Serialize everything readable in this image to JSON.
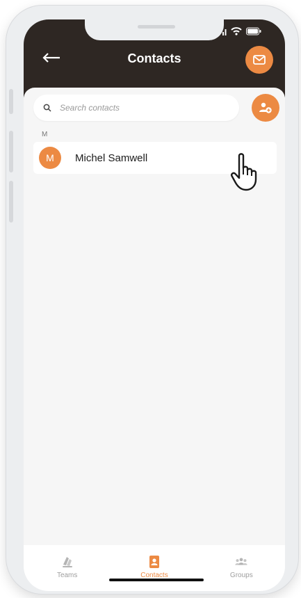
{
  "status_bar": {
    "icons": [
      "signal-icon",
      "wifi-icon",
      "battery-icon"
    ]
  },
  "header": {
    "title": "Contacts",
    "back_icon": "back-arrow-icon",
    "action_icon": "mail-icon"
  },
  "search": {
    "placeholder": "Search contacts",
    "value": ""
  },
  "add_contact_icon": "add-contact-icon",
  "contacts": {
    "sections": [
      {
        "letter": "M",
        "items": [
          {
            "initial": "M",
            "name": "Michel Samwell"
          }
        ]
      }
    ]
  },
  "tab_bar": {
    "tabs": [
      {
        "label": "Teams",
        "icon": "teams-icon",
        "active": false
      },
      {
        "label": "Contacts",
        "icon": "contacts-icon",
        "active": true
      },
      {
        "label": "Groups",
        "icon": "groups-icon",
        "active": false
      }
    ]
  },
  "colors": {
    "header_bg": "#2e2723",
    "accent": "#ec8a43",
    "screen_bg": "#f6f6f6",
    "inactive_tab": "#9e9e9e"
  }
}
